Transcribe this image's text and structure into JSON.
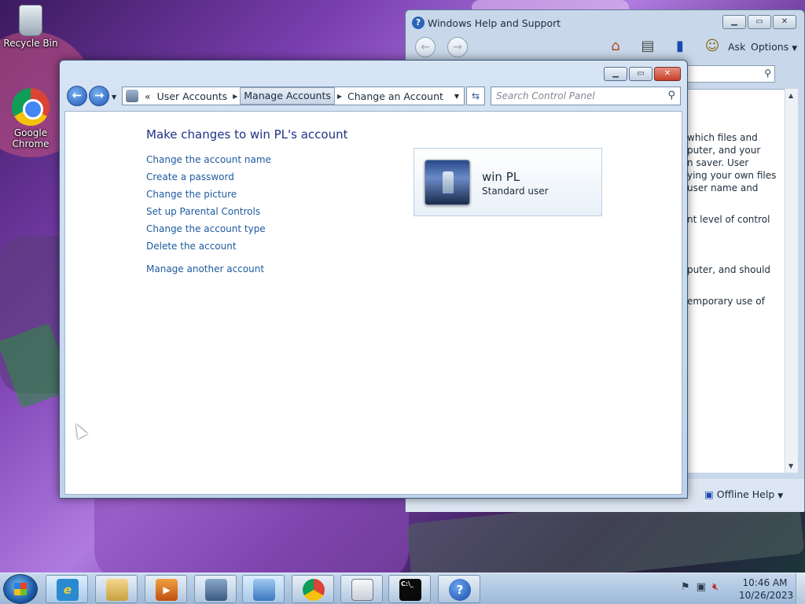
{
  "desktop": {
    "icons": [
      {
        "label": "Recycle Bin",
        "icon": "recycle-bin-icon"
      },
      {
        "label": "Google Chrome",
        "icon": "chrome-icon"
      }
    ]
  },
  "help_window": {
    "title": "Windows Help and Support",
    "toolbar": {
      "ask_label": "Ask",
      "options_label": "Options"
    },
    "visible_text_lines": [
      "which files and",
      "puter, and your",
      "n saver. User",
      "ying your own files",
      " user name and",
      "nt level of control",
      "puter, and should",
      "emporary use of"
    ],
    "footer": {
      "offline_help_label": "Offline Help"
    }
  },
  "control_panel": {
    "breadcrumb": {
      "overflow": "«",
      "items": [
        "User Accounts",
        "Manage Accounts",
        "Change an Account"
      ]
    },
    "search": {
      "placeholder": "Search Control Panel"
    },
    "heading": "Make changes to win PL's account",
    "links": [
      "Change the account name",
      "Create a password",
      "Change the picture",
      "Set up Parental Controls",
      "Change the account type",
      "Delete the account"
    ],
    "manage_another": "Manage another account",
    "account": {
      "name": "win PL",
      "type": "Standard user"
    }
  },
  "taskbar": {
    "clock": {
      "time": "10:46 AM",
      "date": "10/26/2023"
    }
  },
  "colors": {
    "link": "#1e5a9e",
    "heading": "#1e3287",
    "taskbar": "#9cb8d8"
  }
}
